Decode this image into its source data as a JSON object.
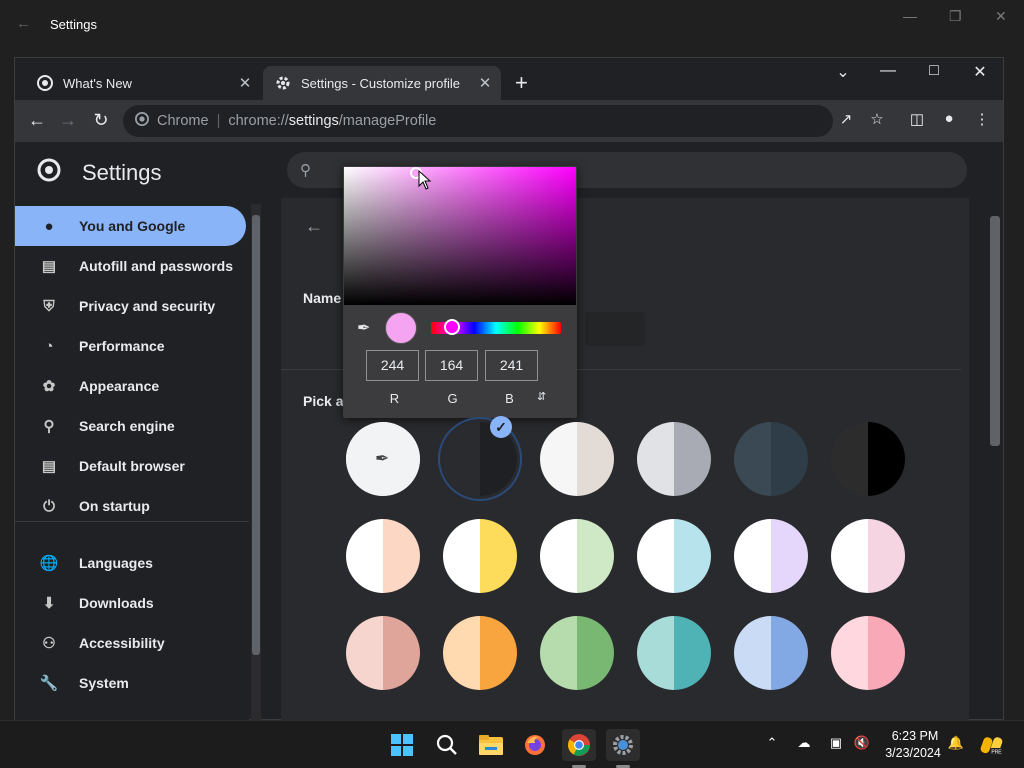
{
  "outer_window": {
    "title": "Settings"
  },
  "tabs": [
    {
      "label": "What's New"
    },
    {
      "label": "Settings - Customize profile"
    }
  ],
  "omnibox": {
    "site_label": "Chrome",
    "url_prefix": "chrome://",
    "url_host": "settings",
    "url_path": "/manageProfile"
  },
  "header": {
    "title": "Settings"
  },
  "sidebar": {
    "items": [
      {
        "label": "You and Google",
        "icon": "person-icon",
        "active": true
      },
      {
        "label": "Autofill and passwords",
        "icon": "clipboard-icon"
      },
      {
        "label": "Privacy and security",
        "icon": "shield-icon"
      },
      {
        "label": "Performance",
        "icon": "speedometer-icon"
      },
      {
        "label": "Appearance",
        "icon": "palette-icon"
      },
      {
        "label": "Search engine",
        "icon": "search-icon"
      },
      {
        "label": "Default browser",
        "icon": "browser-icon"
      },
      {
        "label": "On startup",
        "icon": "power-icon"
      },
      {
        "label": "Languages",
        "icon": "globe-icon"
      },
      {
        "label": "Downloads",
        "icon": "download-icon"
      },
      {
        "label": "Accessibility",
        "icon": "accessibility-icon"
      },
      {
        "label": "System",
        "icon": "wrench-icon"
      }
    ]
  },
  "main": {
    "name_label": "Name",
    "pick_label": "Pick a"
  },
  "color_picker": {
    "r": "244",
    "g": "164",
    "b": "241",
    "r_label": "R",
    "g_label": "G",
    "b_label": "B",
    "selected_color": "#f4a4f1"
  },
  "swatches": [
    {
      "left": "#f1f3f4",
      "right": "#f1f3f4",
      "custom": true
    },
    {
      "left": "#2a2b2e",
      "right": "#1f2023",
      "selected": true
    },
    {
      "left": "#f6f6f6",
      "right": "#e3dcd6"
    },
    {
      "left": "#e0e2e6",
      "right": "#a8abb3"
    },
    {
      "left": "#3b4954",
      "right": "#2f3d48"
    },
    {
      "left": "#2c2c2c",
      "right": "#000000"
    },
    {
      "left": "#ffffff",
      "right": "#fcd7c4"
    },
    {
      "left": "#ffffff",
      "right": "#fedc5b"
    },
    {
      "left": "#ffffff",
      "right": "#cfe8c5"
    },
    {
      "left": "#ffffff",
      "right": "#b7e3ed"
    },
    {
      "left": "#ffffff",
      "right": "#e5d6fb"
    },
    {
      "left": "#ffffff",
      "right": "#f6d5e3"
    },
    {
      "left": "#f5d5cd",
      "right": "#e0a59a"
    },
    {
      "left": "#ffd9b0",
      "right": "#f9a53f"
    },
    {
      "left": "#b6dcad",
      "right": "#79b872"
    },
    {
      "left": "#a8dcd9",
      "right": "#4fb2b5"
    },
    {
      "left": "#c9dbf5",
      "right": "#83a9e4"
    },
    {
      "left": "#ffd7de",
      "right": "#f8a8b7"
    }
  ],
  "taskbar": {
    "time": "6:23 PM",
    "date": "3/23/2024"
  }
}
